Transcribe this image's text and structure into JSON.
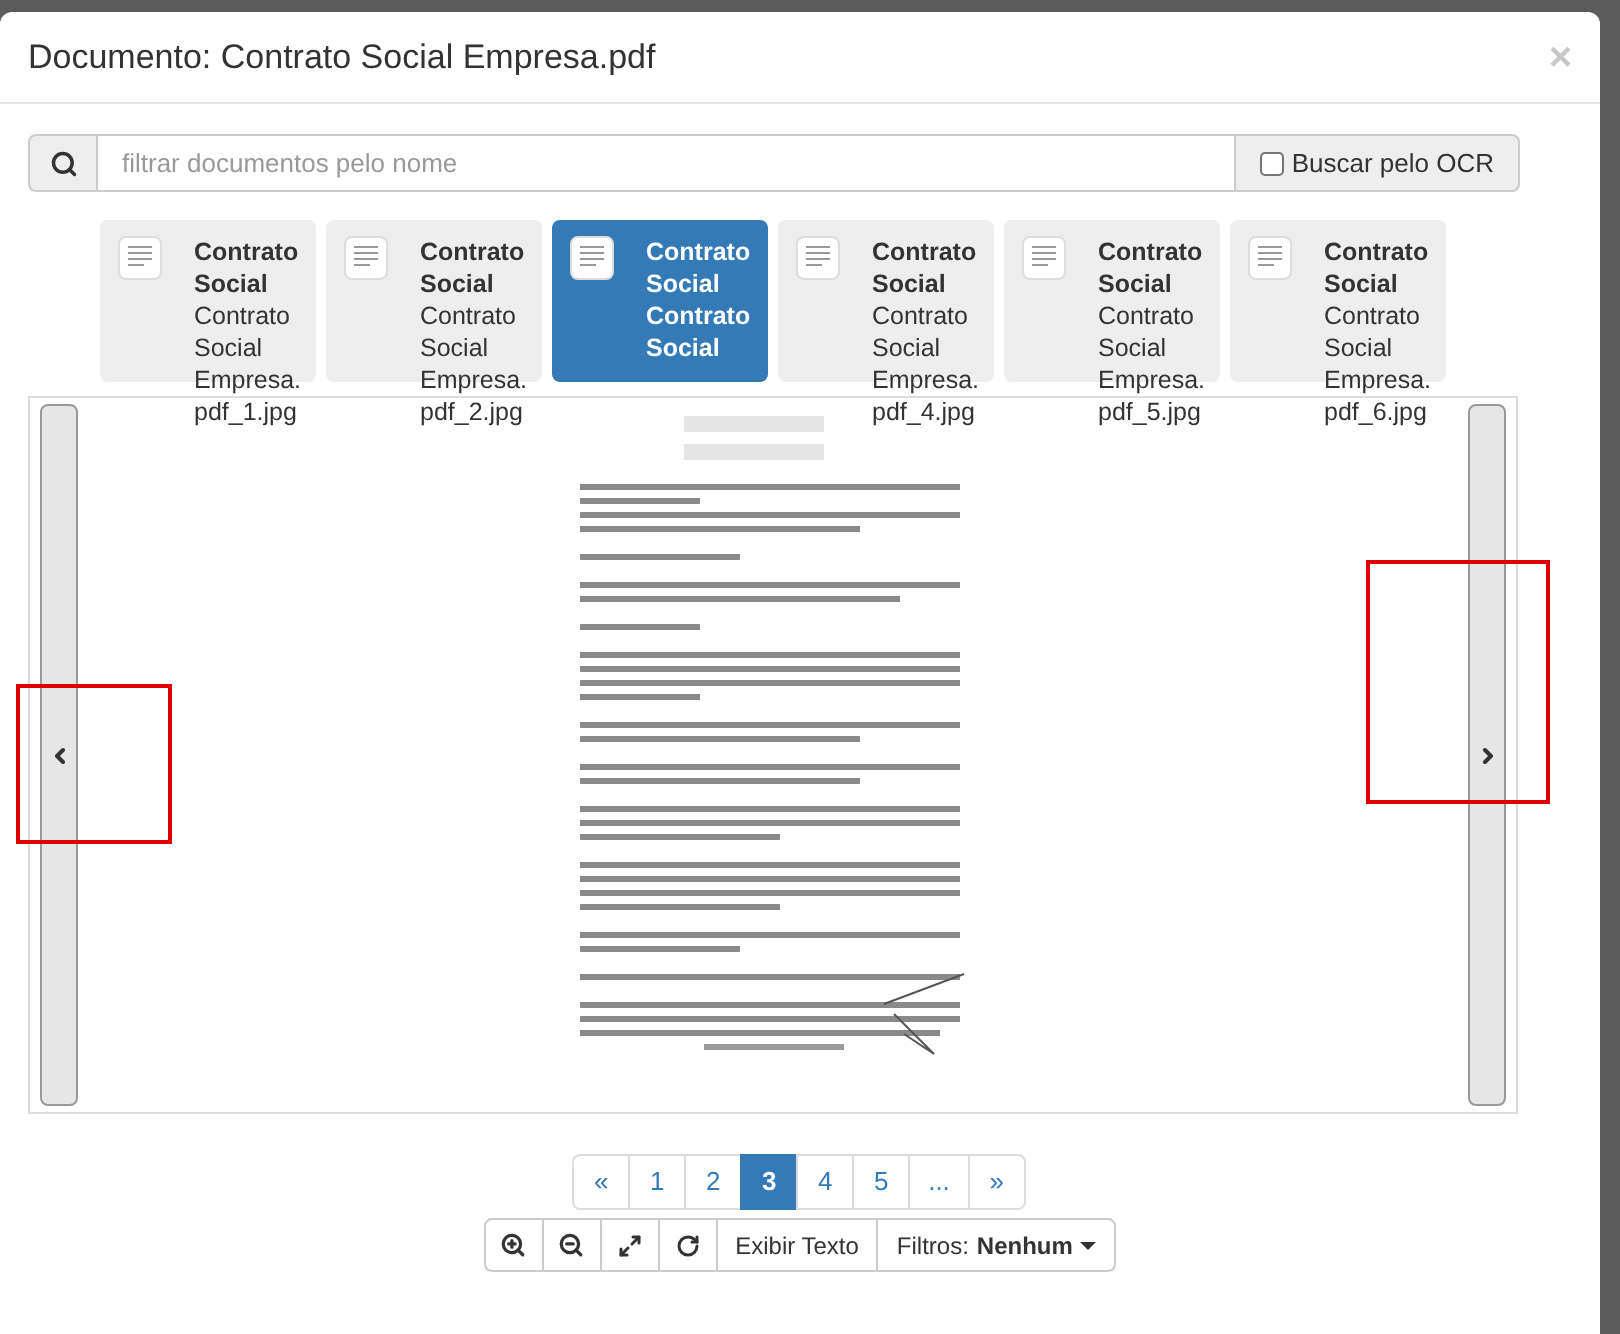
{
  "modal": {
    "title": "Documento: Contrato Social Empresa.pdf",
    "close": "×"
  },
  "search": {
    "placeholder": "filtrar documentos pelo nome",
    "ocr": {
      "label": "Buscar pelo OCR",
      "checked": false
    }
  },
  "thumbnails": [
    {
      "title": "Contrato Social",
      "subtitle": "Contrato Social Empresa. pdf_1.jpg",
      "selected": false
    },
    {
      "title": "Contrato Social",
      "subtitle": "Contrato Social Empresa. pdf_2.jpg",
      "selected": false
    },
    {
      "title": "Contrato Social",
      "subtitle": "Contrato Social",
      "selected": true
    },
    {
      "title": "Contrato Social",
      "subtitle": "Contrato Social Empresa. pdf_4.jpg",
      "selected": false
    },
    {
      "title": "Contrato Social",
      "subtitle": "Contrato Social Empresa. pdf_5.jpg",
      "selected": false
    },
    {
      "title": "Contrato Social",
      "subtitle": "Contrato Social Empresa. pdf_6.jpg",
      "selected": false
    }
  ],
  "pagination": [
    {
      "label": "«",
      "selected": false
    },
    {
      "label": "1",
      "selected": false
    },
    {
      "label": "2",
      "selected": false
    },
    {
      "label": "3",
      "selected": true
    },
    {
      "label": "4",
      "selected": false
    },
    {
      "label": "5",
      "selected": false
    },
    {
      "label": "...",
      "selected": false
    },
    {
      "label": "»",
      "selected": false
    }
  ],
  "toolbar": {
    "show_text": "Exibir Texto",
    "filters_label": "Filtros:",
    "filters_value": "Nenhum"
  }
}
